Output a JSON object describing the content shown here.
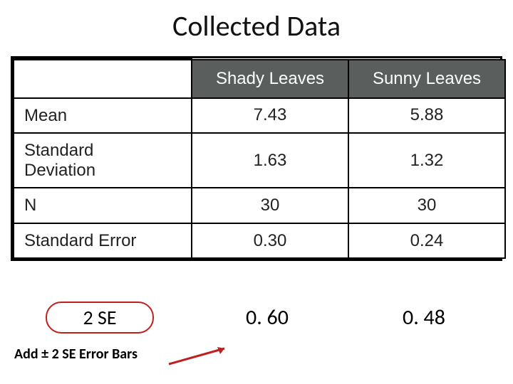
{
  "title": "Collected Data",
  "table": {
    "headers": {
      "col1": "Shady Leaves",
      "col2": "Sunny Leaves"
    },
    "rows": [
      {
        "label": "Mean",
        "v1": "7.43",
        "v2": "5.88"
      },
      {
        "label": "Standard\nDeviation",
        "v1": "1.63",
        "v2": "1.32"
      },
      {
        "label": "N",
        "v1": "30",
        "v2": "30"
      },
      {
        "label": "Standard Error",
        "v1": "0.30",
        "v2": "0.24"
      }
    ]
  },
  "extra": {
    "label": "2 SE",
    "v1": "0. 60",
    "v2": "0. 48"
  },
  "annotation": "Add ± 2 SE Error Bars",
  "chart_data": {
    "type": "table",
    "columns": [
      "",
      "Shady Leaves",
      "Sunny Leaves"
    ],
    "rows": [
      [
        "Mean",
        7.43,
        5.88
      ],
      [
        "Standard Deviation",
        1.63,
        1.32
      ],
      [
        "N",
        30,
        30
      ],
      [
        "Standard Error",
        0.3,
        0.24
      ],
      [
        "2 SE",
        0.6,
        0.48
      ]
    ],
    "title": "Collected Data"
  }
}
